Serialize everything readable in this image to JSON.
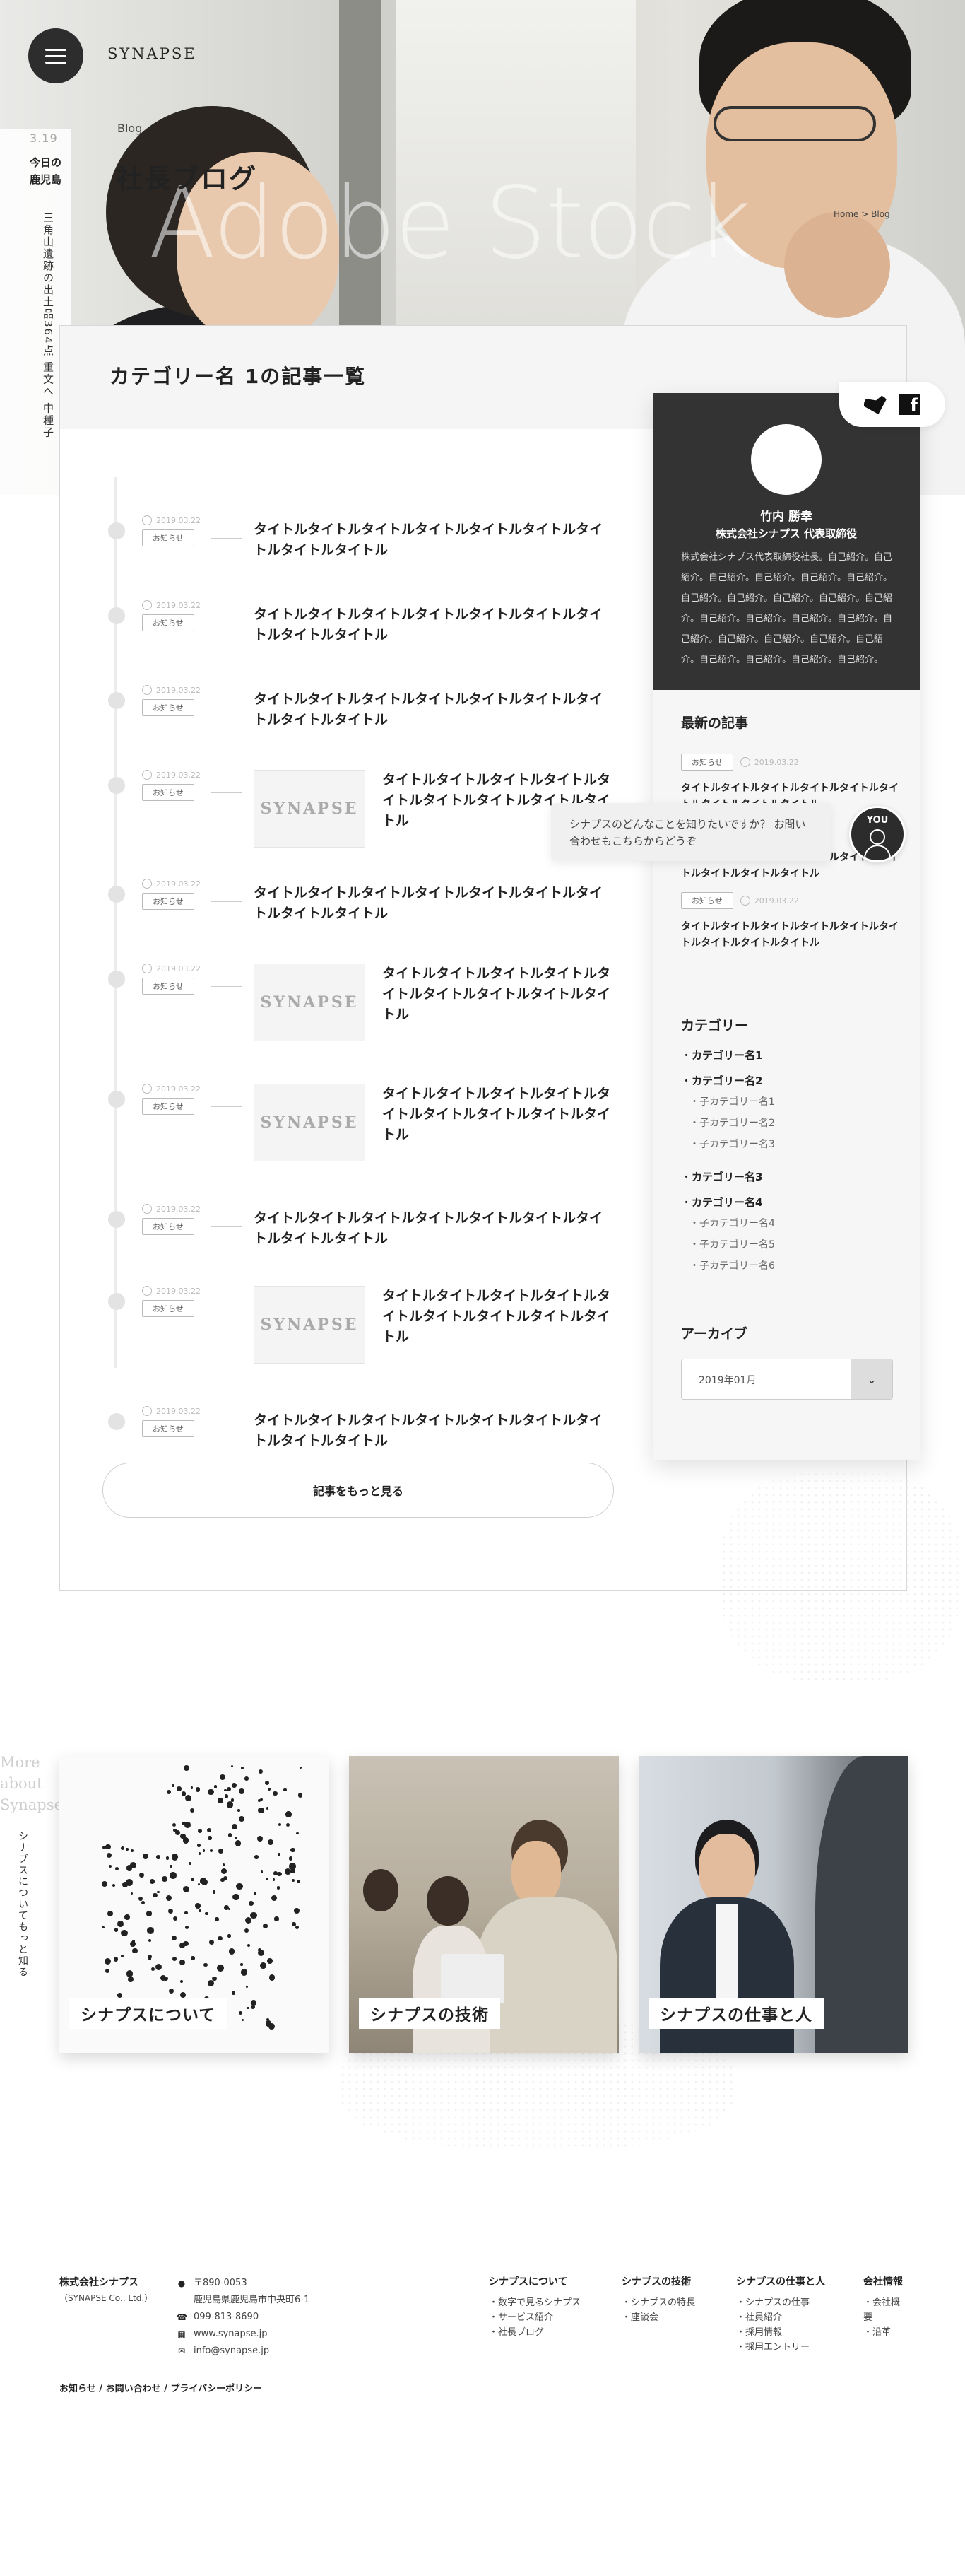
{
  "brand": "SYNAPSE",
  "daily": {
    "date": "3.19",
    "label_line1": "今日の",
    "label_line2": "鹿児島",
    "headline": "三角山遺跡の出土品364点 重文へ 中種子"
  },
  "hero": {
    "crumb": "Blog",
    "title": "社長ブログ",
    "watermark": "Adobe Stock",
    "breadcrumb": "Home > Blog"
  },
  "listing": {
    "heading": "カテゴリー名 1の記事一覧",
    "articles": [
      {
        "date": "2019.03.22",
        "tag": "お知らせ",
        "title": "タイトルタイトルタイトルタイトルタイトルタイトルタイトルタイトルタイトル"
      },
      {
        "date": "2019.03.22",
        "tag": "お知らせ",
        "title": "タイトルタイトルタイトルタイトルタイトルタイトルタイトルタイトルタイトル"
      },
      {
        "date": "2019.03.22",
        "tag": "お知らせ",
        "title": "タイトルタイトルタイトルタイトルタイトルタイトルタイトルタイトルタイトル"
      },
      {
        "date": "2019.03.22",
        "tag": "お知らせ",
        "title": "タイトルタイトルタイトルタイトルタイトルタイトルタイトルタイトルタイトル",
        "thumb": "SYNAPSE"
      },
      {
        "date": "2019.03.22",
        "tag": "お知らせ",
        "title": "タイトルタイトルタイトルタイトルタイトルタイトルタイトルタイトルタイトル"
      },
      {
        "date": "2019.03.22",
        "tag": "お知らせ",
        "title": "タイトルタイトルタイトルタイトルタイトルタイトルタイトルタイトルタイトル",
        "thumb": "SYNAPSE"
      },
      {
        "date": "2019.03.22",
        "tag": "お知らせ",
        "title": "タイトルタイトルタイトルタイトルタイトルタイトルタイトルタイトルタイトル",
        "thumb": "SYNAPSE"
      },
      {
        "date": "2019.03.22",
        "tag": "お知らせ",
        "title": "タイトルタイトルタイトルタイトルタイトルタイトルタイトルタイトルタイトル"
      },
      {
        "date": "2019.03.22",
        "tag": "お知らせ",
        "title": "タイトルタイトルタイトルタイトルタイトルタイトルタイトルタイトルタイトル",
        "thumb": "SYNAPSE"
      },
      {
        "date": "2019.03.22",
        "tag": "お知らせ",
        "title": "タイトルタイトルタイトルタイトルタイトルタイトルタイトルタイトルタイトル"
      }
    ],
    "more_label": "記事をもっと見る"
  },
  "profile": {
    "name": "竹内 勝幸",
    "role": "株式会社シナプス 代表取締役",
    "bio": "株式会社シナプス代表取締役社長。自己紹介。自己紹介。自己紹介。自己紹介。自己紹介。自己紹介。自己紹介。自己紹介。自己紹介。自己紹介。自己紹介。自己紹介。自己紹介。自己紹介。自己紹介。自己紹介。自己紹介。自己紹介。自己紹介。自己紹介。自己紹介。自己紹介。自己紹介。自己紹介。"
  },
  "sidebar": {
    "recent_heading": "最新の記事",
    "recent": [
      {
        "tag": "お知らせ",
        "date": "2019.03.22",
        "title": "タイトルタイトルタイトルタイトルタイトルタイトルタイトルタイトルタイトル"
      },
      {
        "tag": "お知らせ",
        "date": "2019.03.22",
        "title": "タイトルタイトルタイトルタイトルタイトルタイトルタイトルタイトルタイトル"
      },
      {
        "tag": "お知らせ",
        "date": "2019.03.22",
        "title": "タイトルタイトルタイトルタイトルタイトルタイトルタイトルタイトルタイトル"
      }
    ],
    "category_heading": "カテゴリー",
    "categories": [
      {
        "name": "カテゴリー名1",
        "children": []
      },
      {
        "name": "カテゴリー名2",
        "children": [
          "子カテゴリー名1",
          "子カテゴリー名2",
          "子カテゴリー名3"
        ]
      },
      {
        "name": "カテゴリー名3",
        "children": []
      },
      {
        "name": "カテゴリー名4",
        "children": [
          "子カテゴリー名4",
          "子カテゴリー名5",
          "子カテゴリー名6"
        ]
      }
    ],
    "archive_heading": "アーカイブ",
    "archive_value": "2019年01月"
  },
  "chat": {
    "message": "シナプスのどんなことを知りたいですか？ お問い合わせもこちらからどうぞ",
    "avatar_label": "YOU"
  },
  "about": {
    "more_line1": "More",
    "more_line2": "about",
    "more_line3": "Synapse",
    "vertical": "シナプスについてもっと知る",
    "cards": [
      "シナプスについて",
      "シナプスの技術",
      "シナプスの仕事と人"
    ]
  },
  "footer": {
    "company": "株式会社シナプス",
    "company_en": "（SYNAPSE Co., Ltd.）",
    "postal": "〒890-0053",
    "address": "鹿児島県鹿児島市中央町6-1",
    "phone": "099-813-8690",
    "web": "www.synapse.jp",
    "email": "info@synapse.jp",
    "cols": [
      {
        "heading": "シナプスについて",
        "items": [
          "数字で見るシナプス",
          "サービス紹介",
          "社長ブログ"
        ]
      },
      {
        "heading": "シナプスの技術",
        "items": [
          "シナプスの特長",
          "座談会"
        ]
      },
      {
        "heading": "シナプスの仕事と人",
        "items": [
          "シナプスの仕事",
          "社員紹介",
          "採用情報",
          "採用エントリー"
        ]
      },
      {
        "heading": "会社情報",
        "items": [
          "会社概要",
          "沿革"
        ]
      }
    ],
    "bottom_links": [
      "お知らせ",
      "お問い合わせ",
      "プライバシーポリシー"
    ]
  }
}
